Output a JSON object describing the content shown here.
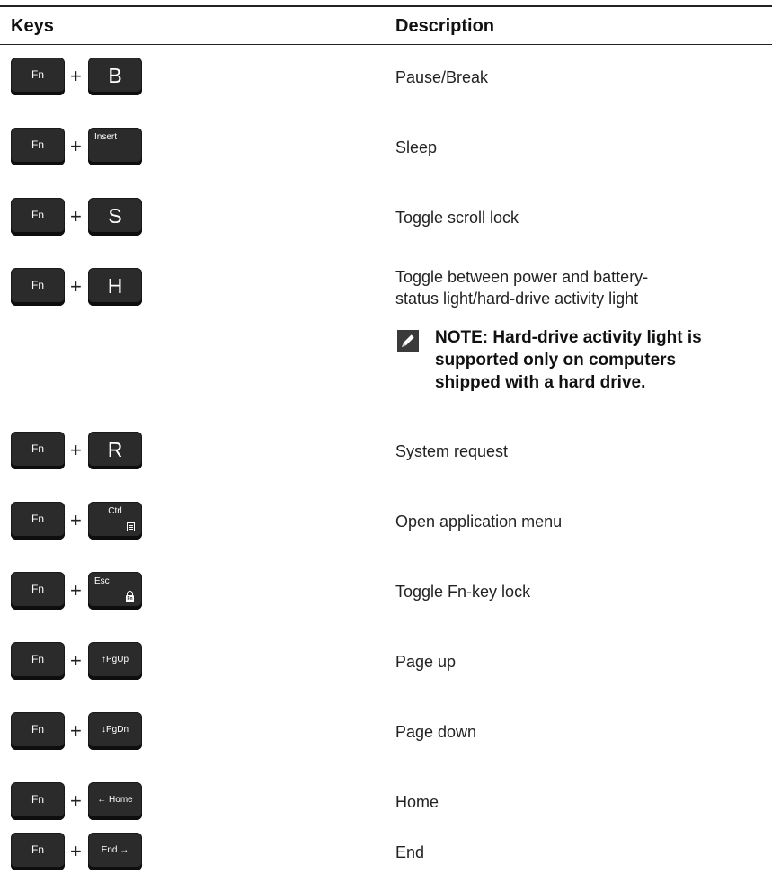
{
  "header": {
    "keys": "Keys",
    "description": "Description"
  },
  "fn_label": "Fn",
  "plus": "+",
  "rows": [
    {
      "key": "B",
      "key_style": "big",
      "description": "Pause/Break"
    },
    {
      "key": "Insert",
      "key_style": "small",
      "description": "Sleep"
    },
    {
      "key": "S",
      "key_style": "big",
      "description": "Toggle scroll lock"
    },
    {
      "key": "H",
      "key_style": "big",
      "description": "Toggle between power and battery-status light/hard-drive activity light",
      "description_line1": "Toggle between power and battery-",
      "description_line2": "status light/hard-drive activity light"
    },
    {
      "key": "R",
      "key_style": "big",
      "description": "System request"
    },
    {
      "key": "Ctrl",
      "key_style": "small",
      "icon": "menu-icon",
      "description": "Open application menu"
    },
    {
      "key": "Esc",
      "key_style": "small",
      "icon": "fn-lock-icon",
      "description": "Toggle Fn-key lock"
    },
    {
      "key": "↑PgUp",
      "key_style": "mid",
      "description": "Page up"
    },
    {
      "key": "↓PgDn",
      "key_style": "mid",
      "description": "Page down"
    },
    {
      "key": "← Home",
      "key_style": "mid",
      "description": "Home"
    },
    {
      "key": "End →",
      "key_style": "mid",
      "description": "End"
    }
  ],
  "note": {
    "icon": "note-pencil-icon",
    "line1": "NOTE: Hard-drive activity light is",
    "line2": "supported only on computers",
    "line3": "shipped with a hard drive."
  }
}
